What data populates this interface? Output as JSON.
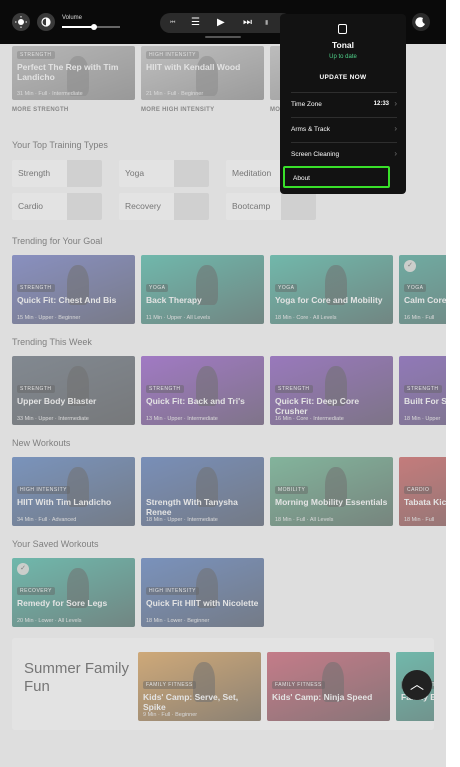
{
  "topbar": {
    "volume_label": "Volume",
    "volume_level": 0.55,
    "left_icons": [
      "brightness-icon",
      "contrast-icon"
    ],
    "media_icons": [
      "speed-icon",
      "queue-icon",
      "play-icon",
      "skip-next-icon",
      "weights-icon"
    ],
    "right_icon": "profile-moon-icon"
  },
  "top_cards": [
    {
      "tag": "STRENGTH",
      "title": "Perfect The Rep with Tim Landicho",
      "meta": "31 Min · Full · Intermediate",
      "color": "#8a8a8a"
    },
    {
      "tag": "HIGH INTENSITY",
      "title": "HIIT with Kendall Wood",
      "meta": "21 Min · Full · Beginner",
      "color": "#a0a0a0"
    },
    {
      "tag": "",
      "title": "",
      "meta": "",
      "color": "#9a9a9a"
    }
  ],
  "more_links": [
    "MORE STRENGTH",
    "MORE HIGH INTENSITY",
    "MO"
  ],
  "sections": {
    "types_title": "Your Top Training Types",
    "trending_goal": "Trending for Your Goal",
    "trending_week": "Trending This Week",
    "new_workouts": "New Workouts",
    "saved": "Your Saved Workouts"
  },
  "training_types": [
    "Strength",
    "Yoga",
    "Meditation",
    "Cardio",
    "Recovery",
    "Bootcamp"
  ],
  "trending_goal": [
    {
      "tag": "STRENGTH",
      "title": "Quick Fit: Chest And Bis",
      "meta": "15 Min · Upper · Beginner",
      "color": "#4a58b8",
      "check": false
    },
    {
      "tag": "YOGA",
      "title": "Back Therapy",
      "meta": "11 Min · Upper · All Levels",
      "color": "#18a890",
      "check": false
    },
    {
      "tag": "YOGA",
      "title": "Yoga for Core and Mobility",
      "meta": "18 Min · Core · All Levels",
      "color": "#1aa88e",
      "check": false
    },
    {
      "tag": "YOGA",
      "title": "Calm Core",
      "meta": "16 Min · Full",
      "color": "#178f7c",
      "check": true
    }
  ],
  "trending_week": [
    {
      "tag": "STRENGTH",
      "title": "Upper Body Blaster",
      "meta": "33 Min · Upper · Intermediate",
      "color": "#3c4a5a",
      "check": false
    },
    {
      "tag": "STRENGTH",
      "title": "Quick Fit: Back and Tri's",
      "meta": "13 Min · Upper · Intermediate",
      "color": "#7a2cc0",
      "check": false
    },
    {
      "tag": "STRENGTH",
      "title": "Quick Fit: Deep Core Crusher",
      "meta": "16 Min · Core · Intermediate",
      "color": "#6a2ab0",
      "check": false
    },
    {
      "tag": "STRENGTH",
      "title": "Built For S Rodonis",
      "meta": "18 Min · Upper",
      "color": "#5a2aa8",
      "check": false
    }
  ],
  "new_workouts": [
    {
      "tag": "HIGH INTENSITY",
      "title": "HIIT With Tim Landicho",
      "meta": "34 Min · Full · Advanced",
      "color": "#2c5fb0",
      "check": false
    },
    {
      "tag": "",
      "title": "Strength With Tanysha Renee",
      "meta": "18 Min · Upper · Intermediate",
      "color": "#2a56a8",
      "check": false
    },
    {
      "tag": "MOBILITY",
      "title": "Morning Mobility Essentials",
      "meta": "18 Min · Full · All Levels",
      "color": "#3ea070",
      "check": false
    },
    {
      "tag": "CARDIO",
      "title": "Tabata Kic",
      "meta": "18 Min · Full",
      "color": "#c03030",
      "check": false
    }
  ],
  "saved_workouts": [
    {
      "tag": "RECOVERY",
      "title": "Remedy for Sore Legs",
      "meta": "20 Min · Lower · All Levels",
      "color": "#17a890",
      "check": true
    },
    {
      "tag": "HIGH INTENSITY",
      "title": "Quick Fit HIIT with Nicolette",
      "meta": "18 Min · Lower · Beginner",
      "color": "#2c5cb0",
      "check": false
    }
  ],
  "summer": {
    "title": "Summer Family Fun",
    "cards": [
      {
        "tag": "FAMILY FITNESS",
        "title": "Kids' Camp: Serve, Set, Spike",
        "meta": "9 Min · Full · Beginner",
        "color": "#d58a2a"
      },
      {
        "tag": "FAMILY FITNESS",
        "title": "Kids' Camp: Ninja Speed",
        "meta": "",
        "color": "#c0304a"
      },
      {
        "tag": "FAMILY FITNESS",
        "title": "Family Bea",
        "meta": "",
        "color": "#1aa88e"
      }
    ]
  },
  "menu": {
    "brand": "Tonal",
    "status": "Up to date",
    "update_button": "UPDATE NOW",
    "items": [
      {
        "label": "Time Zone",
        "value": "12:33"
      },
      {
        "label": "Arms & Track",
        "value": ""
      },
      {
        "label": "Screen Cleaning",
        "value": ""
      },
      {
        "label": "About",
        "value": ""
      }
    ],
    "highlight_color": "#39e02a"
  }
}
